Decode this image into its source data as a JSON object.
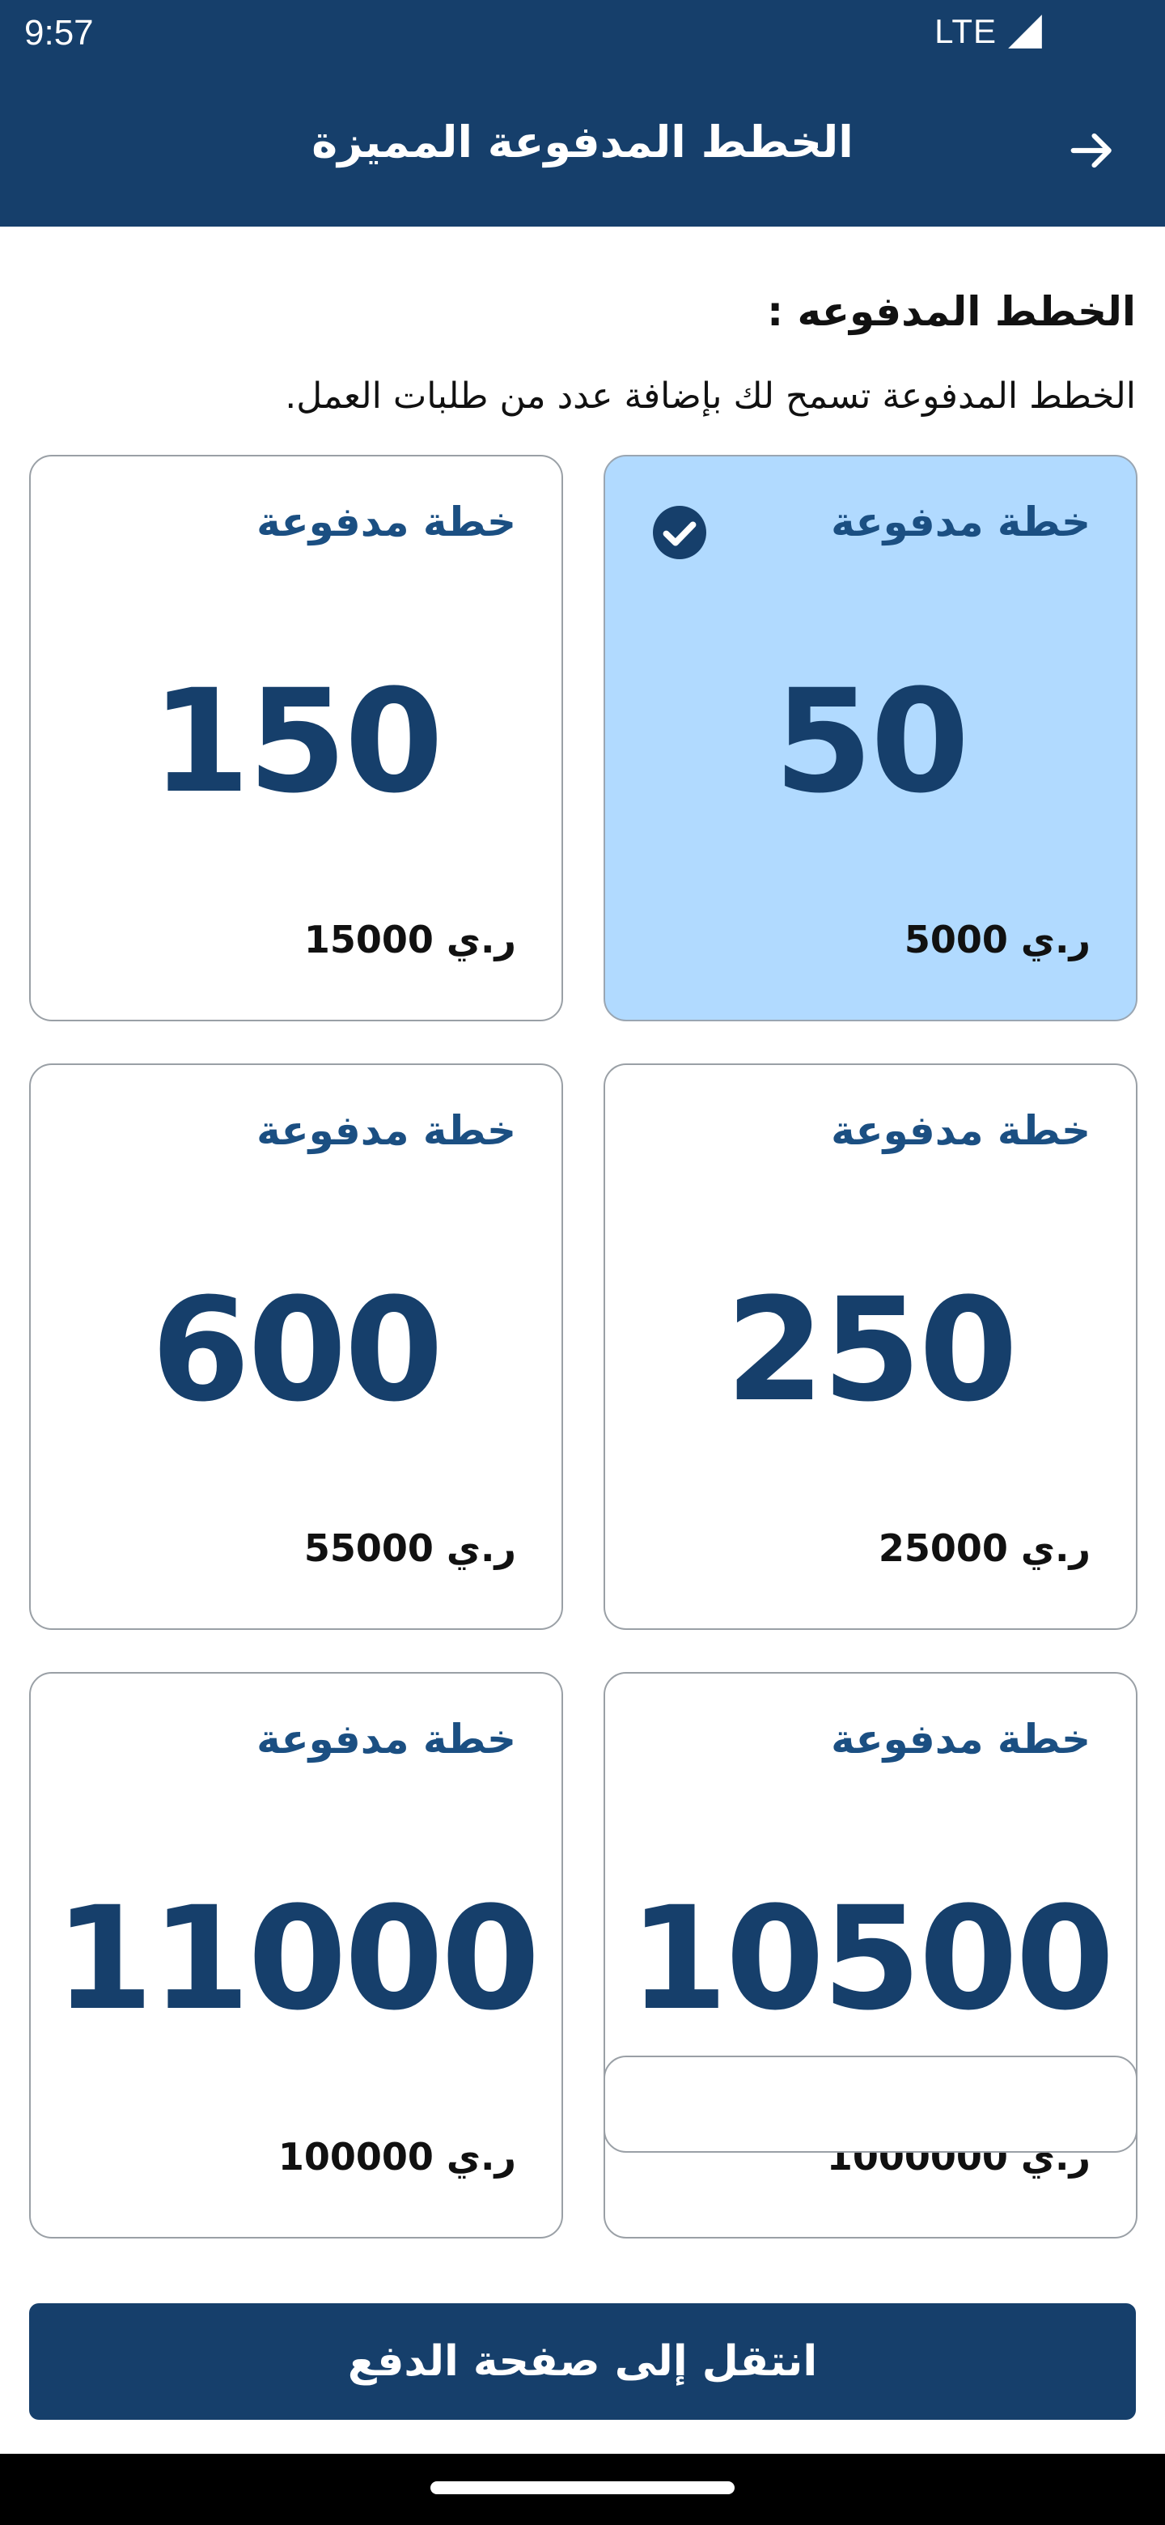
{
  "status_bar": {
    "time": "9:57",
    "network": "LTE",
    "signal_icon": "signal-icon"
  },
  "app_bar": {
    "title": "الخطط المدفوعة المميزة",
    "back_icon": "arrow-right-icon"
  },
  "section": {
    "heading": "الخطط المدفوعه :",
    "description": "الخطط المدفوعة تسمح لك بإضافة عدد من طلبات العمل."
  },
  "plans": [
    {
      "label": "خطة مدفوعة",
      "count": "50",
      "price": "5000 ر.ي",
      "selected": true
    },
    {
      "label": "خطة مدفوعة",
      "count": "150",
      "price": "15000 ر.ي",
      "selected": false
    },
    {
      "label": "خطة مدفوعة",
      "count": "250",
      "price": "25000 ر.ي",
      "selected": false
    },
    {
      "label": "خطة مدفوعة",
      "count": "600",
      "price": "55000 ر.ي",
      "selected": false
    },
    {
      "label": "خطة مدفوعة",
      "count": "10500",
      "price": "1000000 ر.ي",
      "selected": false
    },
    {
      "label": "خطة مدفوعة",
      "count": "11000",
      "price": "100000 ر.ي",
      "selected": false
    }
  ],
  "footer": {
    "pay_button_label": "انتقل إلى صفحة الدفع"
  },
  "colors": {
    "primary": "#163f6b",
    "selected_card": "#b1daff",
    "label_blue": "#1b4f82"
  }
}
